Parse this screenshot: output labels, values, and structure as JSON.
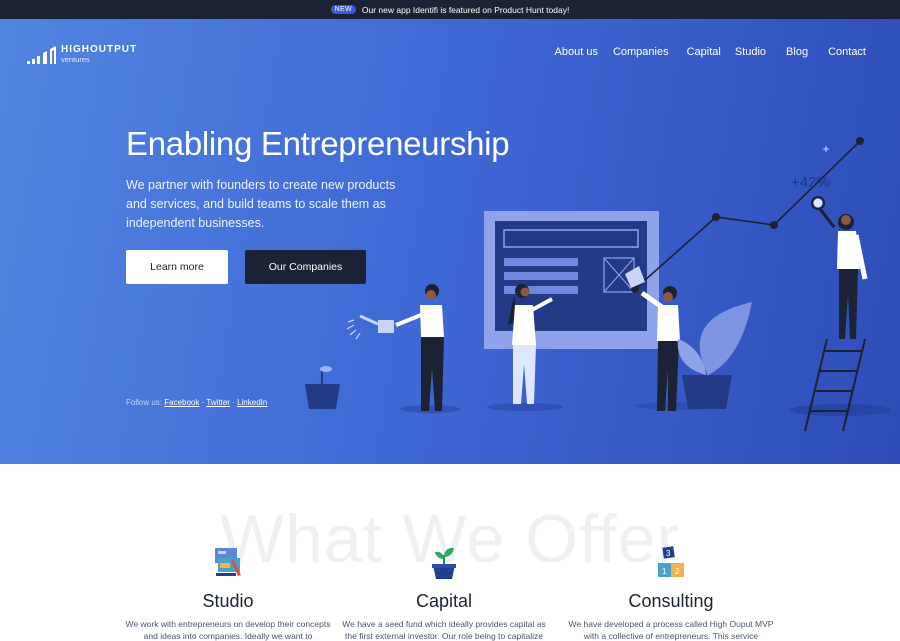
{
  "announcement": {
    "badge": "NEW",
    "message": "Our new app Identifi is featured on Product Hunt today!"
  },
  "brand": {
    "name": "HIGHOUTPUT",
    "sub": "ventures"
  },
  "nav": {
    "items": [
      "About us",
      "Companies",
      "Capital",
      "Studio",
      "Blog",
      "Contact"
    ]
  },
  "hero": {
    "title": "Enabling Entrepreneurship",
    "subtitle": "We partner with founders to create new products and services, and build teams to scale them as independent businesses.",
    "primary_button": "Learn more",
    "secondary_button": "Our Companies",
    "growth_label": "+42%"
  },
  "follow": {
    "label": "Follow us:",
    "links": [
      "Facebook",
      "Twitter",
      "LinkedIn"
    ],
    "separator": "·"
  },
  "offer": {
    "background_title": "What We Offer",
    "items": [
      {
        "title": "Studio",
        "text": "We work with entrepreneurs on develop their concepts and ideas into companies. Ideally we want to",
        "icon": "design-tools-icon"
      },
      {
        "title": "Capital",
        "text": "We have a seed fund which ideally provides capital as the first external investor. Our role being to capitalize",
        "icon": "potted-sprout-icon"
      },
      {
        "title": "Consulting",
        "text": "We have developed a process called High Ouput MVP with a collective of entrepreneurs. This service",
        "icon": "number-blocks-icon"
      }
    ]
  },
  "colors": {
    "hero_start": "#5284e0",
    "hero_end": "#2e4cb8",
    "dark": "#1b2233",
    "badge": "#3d5ad6"
  }
}
